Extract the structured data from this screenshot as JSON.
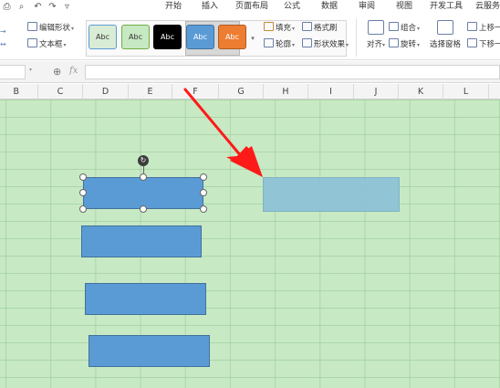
{
  "menubar": {
    "quick_access": [
      "print-icon",
      "print-preview-icon",
      "undo-icon",
      "redo-icon",
      "more-icon"
    ],
    "tabs": [
      "开始",
      "插入",
      "页面布局",
      "公式",
      "数据",
      "审阅",
      "视图",
      "开发工具",
      "云服务"
    ]
  },
  "ribbon": {
    "edit_shape": "编辑形状",
    "text_box": "文本框",
    "style_label": "Abc",
    "fill": "填充",
    "format_painter": "格式刷",
    "outline": "轮廓",
    "shape_effects": "形状效果",
    "align": "对齐",
    "group": "组合",
    "rotate": "旋转",
    "selection_pane": "选择窗格",
    "bring_forward": "上移一",
    "send_backward": "下移一"
  },
  "style_swatches": [
    {
      "label": "Abc",
      "fill": "#d9ecd5",
      "border": "#5b9bd5",
      "text": "#333333"
    },
    {
      "label": "Abc",
      "fill": "#c6e8c2",
      "border": "#70ad47",
      "text": "#333333"
    },
    {
      "label": "Abc",
      "fill": "#000000",
      "border": "#000000",
      "text": "#ffffff"
    },
    {
      "label": "Abc",
      "fill": "#5b9bd5",
      "border": "#41719c",
      "text": "#ffffff"
    },
    {
      "label": "Abc",
      "fill": "#ed7d31",
      "border": "#ae5a21",
      "text": "#ffffff"
    }
  ],
  "formula_bar": {
    "name_box": "",
    "fx_label": "fx",
    "formula": ""
  },
  "columns": [
    "B",
    "C",
    "D",
    "E",
    "F",
    "G",
    "H",
    "I",
    "J",
    "K",
    "L"
  ],
  "colors": {
    "grid_background": "#c7e9c4",
    "shape_fill": "#5b9bd5",
    "target_fill": "#8fc3d6",
    "arrow": "#ff1a1a"
  }
}
